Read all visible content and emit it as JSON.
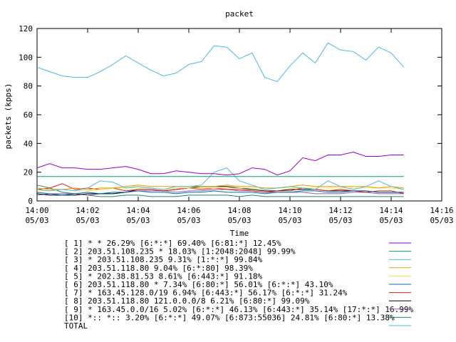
{
  "chart_data": {
    "type": "line",
    "title": "packet",
    "xlabel": "Time",
    "ylabel": "packets (kpps)",
    "x_ticks": [
      {
        "time": "14:00",
        "date": "05/03"
      },
      {
        "time": "14:02",
        "date": "05/03"
      },
      {
        "time": "14:04",
        "date": "05/03"
      },
      {
        "time": "14:06",
        "date": "05/03"
      },
      {
        "time": "14:08",
        "date": "05/03"
      },
      {
        "time": "14:10",
        "date": "05/03"
      },
      {
        "time": "14:12",
        "date": "05/03"
      },
      {
        "time": "14:14",
        "date": "05/03"
      },
      {
        "time": "14:16",
        "date": "05/03"
      }
    ],
    "xlim_minutes": [
      0,
      16
    ],
    "y_ticks": [
      "0",
      "20",
      "40",
      "60",
      "80",
      "100",
      "120"
    ],
    "ylim": [
      0,
      120
    ],
    "grid": false,
    "legend_position": "below",
    "x": [
      0,
      0.5,
      1,
      1.5,
      2,
      2.5,
      3,
      3.5,
      4,
      4.5,
      5,
      5.5,
      6,
      6.5,
      7,
      7.5,
      8,
      8.5,
      9,
      9.5,
      10,
      10.5,
      11,
      11.5,
      12,
      12.5,
      13,
      13.5,
      14,
      14.5
    ],
    "series": [
      {
        "name": "[ 1] * * 26.29%  [6:*:*] 69.40% [6:81:*] 12.45%",
        "color": "#9400d3",
        "values": [
          23,
          26,
          23,
          23,
          22,
          22,
          23,
          24,
          22,
          19,
          19,
          21,
          20,
          19,
          19,
          18,
          19,
          23,
          22,
          18,
          21,
          30,
          28,
          32,
          32,
          34,
          31,
          31,
          32,
          32
        ]
      },
      {
        "name": "[ 2] 203.51.108.235 * 18.03%  [1:2048:2048] 99.99%",
        "color": "#009e73",
        "values": [
          17,
          17,
          17,
          17,
          17,
          17,
          17,
          17,
          17,
          17,
          17,
          17,
          17,
          17,
          17,
          17,
          17,
          17,
          17,
          17,
          17,
          17,
          17,
          17,
          17,
          17,
          17,
          17,
          17,
          17
        ]
      },
      {
        "name": "[ 3] * 203.51.108.235 9.31%  [1:*:*] 99.84%",
        "color": "#56b4e9",
        "values": [
          8,
          7,
          8,
          7,
          9,
          14,
          13,
          9,
          10,
          9,
          8,
          10,
          10,
          11,
          20,
          23,
          14,
          11,
          8,
          9,
          10,
          9,
          8,
          14,
          10,
          8,
          10,
          14,
          10,
          8
        ]
      },
      {
        "name": "[ 4] 203.51.118.80 9.04%  [6:*:80] 98.39%",
        "color": "#e69f00",
        "values": [
          9,
          8,
          8,
          9,
          8,
          9,
          9,
          10,
          11,
          10,
          10,
          10,
          10,
          10,
          10,
          11,
          10,
          10,
          9,
          9,
          10,
          11,
          10,
          10,
          10,
          10,
          10,
          9,
          10,
          9
        ]
      },
      {
        "name": "[ 5] * 202.38.81.53 8.61%  [6:443:*] 91.18%",
        "color": "#f0e442",
        "values": [
          7,
          7,
          8,
          7,
          7,
          8,
          9,
          9,
          9,
          9,
          8,
          9,
          9,
          9,
          9,
          9,
          9,
          9,
          8,
          9,
          9,
          9,
          9,
          9,
          9,
          9,
          9,
          9,
          9,
          8
        ]
      },
      {
        "name": "[ 6] 203.51.118.80 * 7.34%  [6:80:*] 56.01% [6:*:*] 43.10%",
        "color": "#0072b2",
        "values": [
          6,
          5,
          4,
          5,
          6,
          5,
          6,
          6,
          7,
          6,
          6,
          5,
          6,
          6,
          7,
          6,
          6,
          6,
          5,
          6,
          6,
          7,
          7,
          6,
          6,
          7,
          7,
          6,
          6,
          6
        ]
      },
      {
        "name": "[ 7] * 163.45.128.0/19 6.94%  [6:443:*] 56.17% [6:*:*] 31.24%",
        "color": "#e51e10",
        "values": [
          8,
          9,
          12,
          8,
          9,
          8,
          9,
          7,
          8,
          8,
          7,
          8,
          9,
          8,
          9,
          8,
          8,
          7,
          6,
          7,
          7,
          9,
          8,
          7,
          8,
          7,
          6,
          7,
          7,
          5
        ]
      },
      {
        "name": "[ 8] 203.51.118.80 121.0.0.0/8 6.21%  [6:80:*] 99.09%",
        "color": "#000000",
        "values": [
          5,
          4,
          4,
          4,
          5,
          5,
          5,
          6,
          8,
          8,
          7,
          8,
          9,
          10,
          10,
          10,
          9,
          8,
          7,
          7,
          8,
          8,
          8,
          7,
          7,
          7,
          7,
          6,
          6,
          6
        ]
      },
      {
        "name": "[ 9] * 163.45.0.0/16 5.02%  [6:*:*] 46.13% [6:443:*] 35.14% [17:*:*] 16.99%",
        "color": "#9b59b6",
        "values": [
          4,
          5,
          5,
          5,
          4,
          5,
          5,
          6,
          7,
          7,
          7,
          6,
          7,
          7,
          8,
          8,
          7,
          7,
          6,
          6,
          6,
          6,
          5,
          5,
          5,
          6,
          6,
          5,
          5,
          5
        ]
      },
      {
        "name": "[10] *:: *:: 3.20%  [6:*:*] 49.07% [6:873:55036] 24.81% [6:80:*] 13.38%",
        "color": "#1a8f5a",
        "values": [
          11,
          9,
          6,
          5,
          4,
          3,
          3,
          4,
          4,
          3,
          3,
          3,
          4,
          4,
          4,
          4,
          3,
          4,
          3,
          3,
          3,
          3,
          3,
          3,
          3,
          3,
          3,
          3,
          3,
          3
        ]
      },
      {
        "name": "TOTAL",
        "color": "#4db8e6",
        "values": [
          93,
          90,
          87,
          86,
          86,
          90,
          95,
          101,
          96,
          91,
          87,
          89,
          95,
          97,
          108,
          107,
          99,
          103,
          86,
          83,
          94,
          103,
          96,
          110,
          105,
          104,
          98,
          107,
          103,
          93
        ]
      }
    ]
  }
}
